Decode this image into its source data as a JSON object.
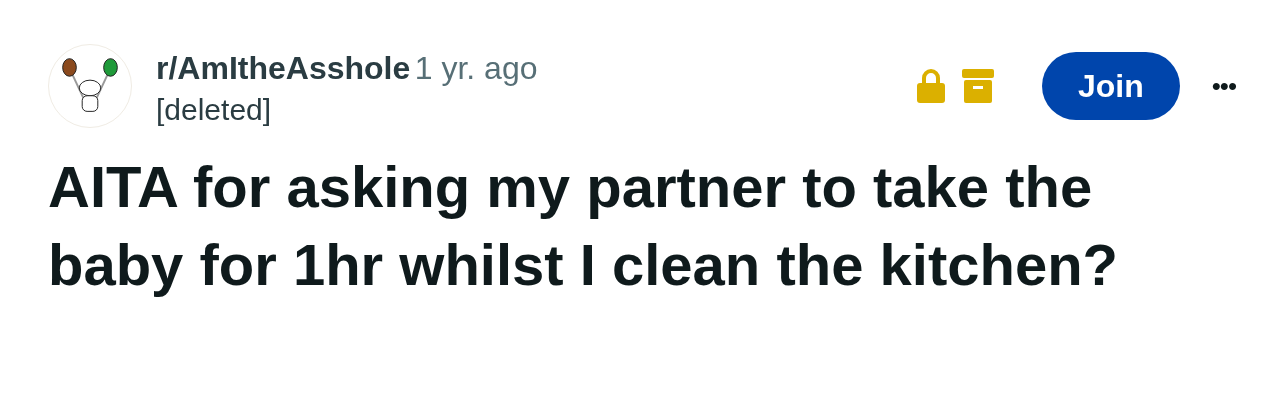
{
  "post": {
    "subreddit": "r/AmItheAsshole",
    "time": "1 yr. ago",
    "author": "[deleted]",
    "locked": true,
    "archived": true,
    "join_button": "Join",
    "more_button": "•••",
    "title": "AITA for asking my partner to take the baby for 1hr whilst I clean the kitchen?"
  }
}
